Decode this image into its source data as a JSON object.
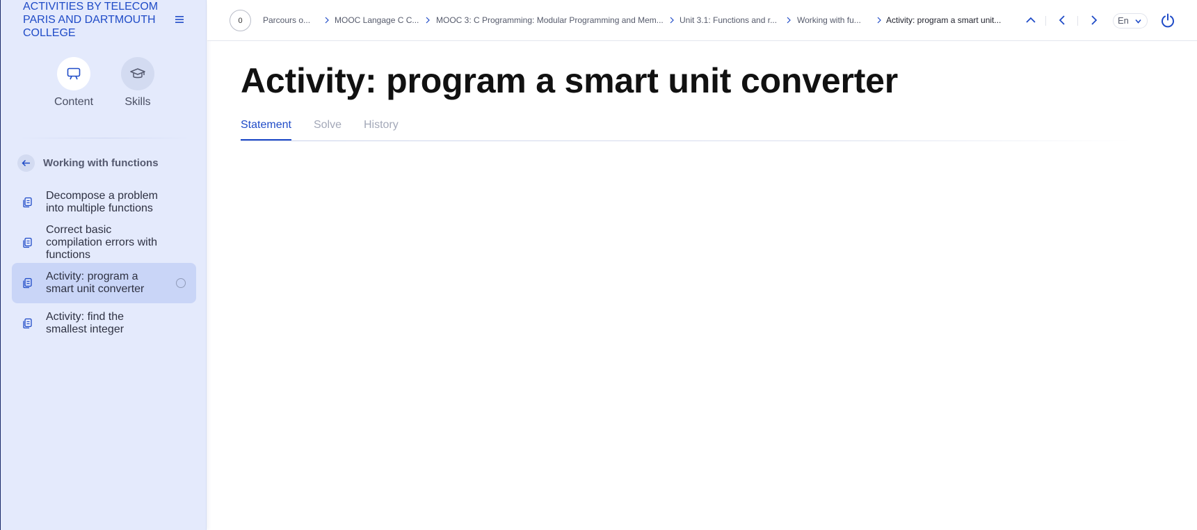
{
  "sidebar": {
    "header": "Activities by Telecom Paris and Dartmouth College",
    "modes": [
      {
        "label": "Content"
      },
      {
        "label": "Skills"
      }
    ],
    "chapter_title": "Working with functions",
    "items": [
      {
        "label": "Decompose a problem into multiple functions"
      },
      {
        "label": "Correct basic compilation errors with functions"
      },
      {
        "label": "Activity: program a smart unit converter"
      },
      {
        "label": "Activity: find the smallest integer"
      }
    ],
    "active_item_index": 2
  },
  "topbar": {
    "score": "0",
    "breadcrumbs": [
      {
        "label": "Parcours o..."
      },
      {
        "label": "MOOC Langage C C..."
      },
      {
        "label": "MOOC 3: C Programming: Modular Programming and Mem..."
      },
      {
        "label": "Unit 3.1: Functions and r..."
      },
      {
        "label": "Working with fu..."
      },
      {
        "label": "Activity: program a smart unit..."
      }
    ],
    "language": "En"
  },
  "main": {
    "title": "Activity: program a smart unit converter",
    "tabs": [
      {
        "label": "Statement"
      },
      {
        "label": "Solve"
      },
      {
        "label": "History"
      }
    ],
    "active_tab": "Statement"
  },
  "colors": {
    "accent": "#1f4bc7",
    "sidebar_bg": "#e4eafc",
    "active_item_bg": "#c9d5f7"
  }
}
